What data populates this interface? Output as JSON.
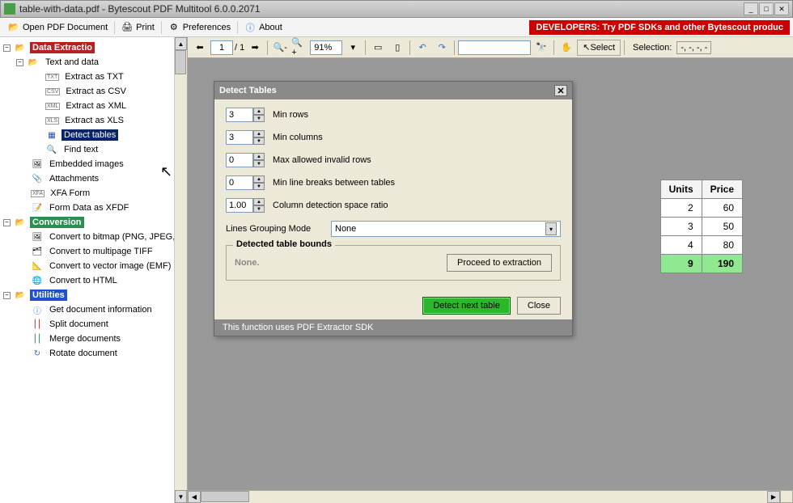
{
  "window": {
    "title": "table-with-data.pdf - Bytescout PDF Multitool 6.0.0.2071"
  },
  "toolbar": {
    "open": "Open PDF Document",
    "print": "Print",
    "prefs": "Preferences",
    "about": "About",
    "dev_banner": "DEVELOPERS: Try PDF SDKs and other Bytescout produc"
  },
  "nav": {
    "page_current": "1",
    "page_total": "/ 1",
    "zoom": "91%",
    "select": "Select",
    "selection_label": "Selection:",
    "selection_value": "-, -, -, -"
  },
  "tree": {
    "data_extraction": "Data Extractio",
    "text_and_data": "Text and data",
    "extract_txt": "Extract as TXT",
    "extract_csv": "Extract as CSV",
    "extract_xml": "Extract as XML",
    "extract_xls": "Extract as XLS",
    "detect_tables": "Detect tables",
    "find_text": "Find text",
    "embedded_images": "Embedded images",
    "attachments": "Attachments",
    "xfa_form": "XFA Form",
    "form_xfdf": "Form Data as XFDF",
    "conversion": "Conversion",
    "conv_bitmap": "Convert to bitmap (PNG, JPEG,",
    "conv_tiff": "Convert to multipage TIFF",
    "conv_vector": "Convert to vector image (EMF)",
    "conv_html": "Convert to HTML",
    "utilities": "Utilities",
    "get_info": "Get document information",
    "split": "Split document",
    "merge": "Merge documents",
    "rotate": "Rotate document"
  },
  "dialog": {
    "title": "Detect Tables",
    "min_rows_label": "Min rows",
    "min_rows_value": "3",
    "min_cols_label": "Min columns",
    "min_cols_value": "3",
    "max_invalid_label": "Max allowed invalid rows",
    "max_invalid_value": "0",
    "min_breaks_label": "Min line breaks between tables",
    "min_breaks_value": "0",
    "col_ratio_label": "Column detection space ratio",
    "col_ratio_value": "1.00",
    "grouping_label": "Lines Grouping Mode",
    "grouping_value": "None",
    "bounds_legend": "Detected table bounds",
    "bounds_none": "None.",
    "proceed": "Proceed to extraction",
    "detect_next": "Detect next table",
    "close": "Close",
    "status": "This function uses PDF Extractor SDK"
  },
  "peek": {
    "h_units": "Units",
    "h_price": "Price",
    "r1u": "2",
    "r1p": "60",
    "r2u": "3",
    "r2p": "50",
    "r3u": "4",
    "r3p": "80",
    "rtu": "9",
    "rtp": "190"
  }
}
